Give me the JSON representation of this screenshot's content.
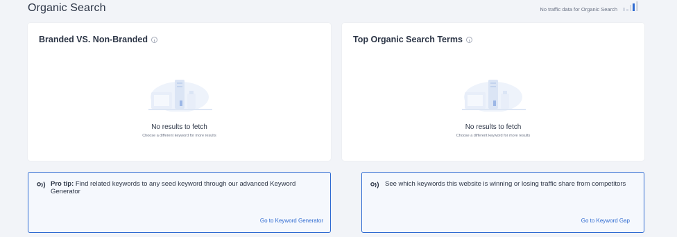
{
  "header": {
    "title": "Organic Search",
    "status_text": "No traffic data for Organic Search",
    "bars_icon": "bar-chart-icon"
  },
  "cards": [
    {
      "title": "Branded VS. Non-Branded",
      "empty_title": "No results to fetch",
      "empty_sub": "Choose a different keyword for more results"
    },
    {
      "title": "Top Organic Search Terms",
      "empty_title": "No results to fetch",
      "empty_sub": "Choose a different keyword for more results"
    }
  ],
  "tips": [
    {
      "bold": "Pro tip:",
      "text": " Find related keywords to any seed keyword through our advanced Keyword Generator",
      "link": "Go to Keyword Generator"
    },
    {
      "bold": "",
      "text": "See which keywords this website is winning or losing traffic share from competitors",
      "link": "Go to Keyword Gap"
    }
  ],
  "colors": {
    "accent": "#2e6ad1",
    "background": "#f2f4f8",
    "card": "#ffffff"
  }
}
